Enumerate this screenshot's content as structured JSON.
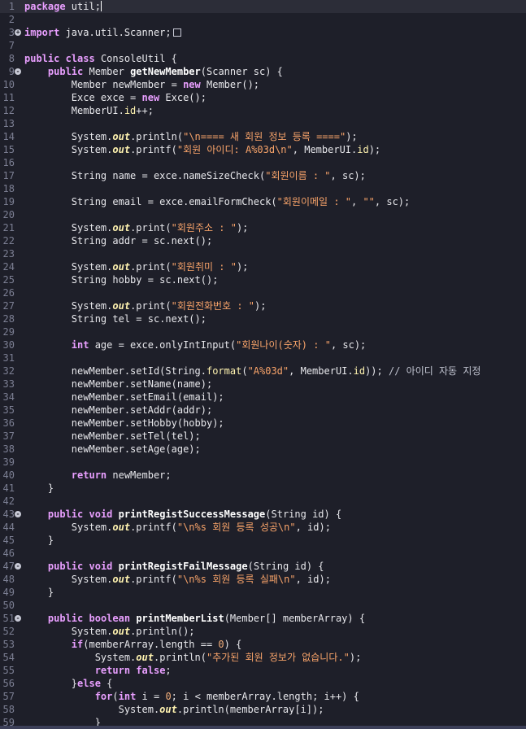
{
  "editor": {
    "lines": [
      {
        "n": "1",
        "tokens": [
          [
            "k",
            "package"
          ],
          [
            "t",
            " util;"
          ]
        ]
      },
      {
        "n": "2",
        "tokens": []
      },
      {
        "n": "3",
        "tokens": [
          [
            "k",
            "import"
          ],
          [
            "t",
            " java.util.Scanner;"
          ]
        ]
      },
      {
        "n": "7",
        "tokens": []
      },
      {
        "n": "8",
        "tokens": [
          [
            "k",
            "public"
          ],
          [
            "t",
            " "
          ],
          [
            "k",
            "class"
          ],
          [
            "t",
            " ConsoleUtil {"
          ]
        ]
      },
      {
        "n": "9",
        "tokens": [
          [
            "t",
            "    "
          ],
          [
            "k",
            "public"
          ],
          [
            "t",
            " Member "
          ],
          [
            "fn",
            "getNewMember"
          ],
          [
            "t",
            "(Scanner sc) {"
          ]
        ]
      },
      {
        "n": "10",
        "tokens": [
          [
            "t",
            "        Member newMember = "
          ],
          [
            "k",
            "new"
          ],
          [
            "t",
            " Member();"
          ]
        ]
      },
      {
        "n": "11",
        "tokens": [
          [
            "t",
            "        Exce exce = "
          ],
          [
            "k",
            "new"
          ],
          [
            "t",
            " Exce();"
          ]
        ]
      },
      {
        "n": "12",
        "tokens": [
          [
            "t",
            "        MemberUI."
          ],
          [
            "m",
            "id"
          ],
          [
            "t",
            "++;"
          ]
        ]
      },
      {
        "n": "13",
        "tokens": []
      },
      {
        "n": "14",
        "tokens": [
          [
            "t",
            "        System."
          ],
          [
            "f",
            "out"
          ],
          [
            "t",
            ".println("
          ],
          [
            "s",
            "\"\\n==== 새 회원 정보 등록 ====\""
          ],
          [
            "t",
            ");"
          ]
        ]
      },
      {
        "n": "15",
        "tokens": [
          [
            "t",
            "        System."
          ],
          [
            "f",
            "out"
          ],
          [
            "t",
            ".printf("
          ],
          [
            "s",
            "\"회원 아이디: A%03d\\n\""
          ],
          [
            "t",
            ", MemberUI."
          ],
          [
            "m",
            "id"
          ],
          [
            "t",
            ");"
          ]
        ]
      },
      {
        "n": "16",
        "tokens": []
      },
      {
        "n": "17",
        "tokens": [
          [
            "t",
            "        String name = exce.nameSizeCheck("
          ],
          [
            "s",
            "\"회원이름 : \""
          ],
          [
            "t",
            ", sc);"
          ]
        ]
      },
      {
        "n": "18",
        "tokens": []
      },
      {
        "n": "19",
        "tokens": [
          [
            "t",
            "        String email = exce.emailFormCheck("
          ],
          [
            "s",
            "\"회원이메일 : \""
          ],
          [
            "t",
            ", "
          ],
          [
            "s",
            "\"\""
          ],
          [
            "t",
            ", sc);"
          ]
        ]
      },
      {
        "n": "20",
        "tokens": []
      },
      {
        "n": "21",
        "tokens": [
          [
            "t",
            "        System."
          ],
          [
            "f",
            "out"
          ],
          [
            "t",
            ".print("
          ],
          [
            "s",
            "\"회원주소 : \""
          ],
          [
            "t",
            ");"
          ]
        ]
      },
      {
        "n": "22",
        "tokens": [
          [
            "t",
            "        String addr = sc.next();"
          ]
        ]
      },
      {
        "n": "23",
        "tokens": []
      },
      {
        "n": "24",
        "tokens": [
          [
            "t",
            "        System."
          ],
          [
            "f",
            "out"
          ],
          [
            "t",
            ".print("
          ],
          [
            "s",
            "\"회원취미 : \""
          ],
          [
            "t",
            ");"
          ]
        ]
      },
      {
        "n": "25",
        "tokens": [
          [
            "t",
            "        String hobby = sc.next();"
          ]
        ]
      },
      {
        "n": "26",
        "tokens": []
      },
      {
        "n": "27",
        "tokens": [
          [
            "t",
            "        System."
          ],
          [
            "f",
            "out"
          ],
          [
            "t",
            ".print("
          ],
          [
            "s",
            "\"회원전화번호 : \""
          ],
          [
            "t",
            ");"
          ]
        ]
      },
      {
        "n": "28",
        "tokens": [
          [
            "t",
            "        String tel = sc.next();"
          ]
        ]
      },
      {
        "n": "29",
        "tokens": []
      },
      {
        "n": "30",
        "tokens": [
          [
            "t",
            "        "
          ],
          [
            "k",
            "int"
          ],
          [
            "t",
            " age = exce.onlyIntInput("
          ],
          [
            "s",
            "\"회원나이(숫자) : \""
          ],
          [
            "t",
            ", sc);"
          ]
        ]
      },
      {
        "n": "31",
        "tokens": []
      },
      {
        "n": "32",
        "tokens": [
          [
            "t",
            "        newMember.setId(String."
          ],
          [
            "m",
            "format"
          ],
          [
            "t",
            "("
          ],
          [
            "s",
            "\"A%03d\""
          ],
          [
            "t",
            ", MemberUI."
          ],
          [
            "m",
            "id"
          ],
          [
            "t",
            "));"
          ],
          [
            "c",
            " // 아이디 자동 지정"
          ]
        ]
      },
      {
        "n": "33",
        "tokens": [
          [
            "t",
            "        newMember.setName(name);"
          ]
        ]
      },
      {
        "n": "34",
        "tokens": [
          [
            "t",
            "        newMember.setEmail(email);"
          ]
        ]
      },
      {
        "n": "35",
        "tokens": [
          [
            "t",
            "        newMember.setAddr(addr);"
          ]
        ]
      },
      {
        "n": "36",
        "tokens": [
          [
            "t",
            "        newMember.setHobby(hobby);"
          ]
        ]
      },
      {
        "n": "37",
        "tokens": [
          [
            "t",
            "        newMember.setTel(tel);"
          ]
        ]
      },
      {
        "n": "38",
        "tokens": [
          [
            "t",
            "        newMember.setAge(age);"
          ]
        ]
      },
      {
        "n": "39",
        "tokens": []
      },
      {
        "n": "40",
        "tokens": [
          [
            "t",
            "        "
          ],
          [
            "k",
            "return"
          ],
          [
            "t",
            " newMember;"
          ]
        ]
      },
      {
        "n": "41",
        "tokens": [
          [
            "t",
            "    }"
          ]
        ]
      },
      {
        "n": "42",
        "tokens": []
      },
      {
        "n": "43",
        "tokens": [
          [
            "t",
            "    "
          ],
          [
            "k",
            "public"
          ],
          [
            "t",
            " "
          ],
          [
            "k",
            "void"
          ],
          [
            "t",
            " "
          ],
          [
            "fn",
            "printRegistSuccessMessage"
          ],
          [
            "t",
            "(String id) {"
          ]
        ]
      },
      {
        "n": "44",
        "tokens": [
          [
            "t",
            "        System."
          ],
          [
            "f",
            "out"
          ],
          [
            "t",
            ".printf("
          ],
          [
            "s",
            "\"\\n%s 회원 등록 성공\\n\""
          ],
          [
            "t",
            ", id);"
          ]
        ]
      },
      {
        "n": "45",
        "tokens": [
          [
            "t",
            "    }"
          ]
        ]
      },
      {
        "n": "46",
        "tokens": []
      },
      {
        "n": "47",
        "tokens": [
          [
            "t",
            "    "
          ],
          [
            "k",
            "public"
          ],
          [
            "t",
            " "
          ],
          [
            "k",
            "void"
          ],
          [
            "t",
            " "
          ],
          [
            "fn",
            "printRegistFailMessage"
          ],
          [
            "t",
            "(String id) {"
          ]
        ]
      },
      {
        "n": "48",
        "tokens": [
          [
            "t",
            "        System."
          ],
          [
            "f",
            "out"
          ],
          [
            "t",
            ".printf("
          ],
          [
            "s",
            "\"\\n%s 회원 등록 실패\\n\""
          ],
          [
            "t",
            ", id);"
          ]
        ]
      },
      {
        "n": "49",
        "tokens": [
          [
            "t",
            "    }"
          ]
        ]
      },
      {
        "n": "50",
        "tokens": []
      },
      {
        "n": "51",
        "tokens": [
          [
            "t",
            "    "
          ],
          [
            "k",
            "public"
          ],
          [
            "t",
            " "
          ],
          [
            "k",
            "boolean"
          ],
          [
            "t",
            " "
          ],
          [
            "fn",
            "printMemberList"
          ],
          [
            "t",
            "(Member[] memberArray) {"
          ]
        ]
      },
      {
        "n": "52",
        "tokens": [
          [
            "t",
            "        System."
          ],
          [
            "f",
            "out"
          ],
          [
            "t",
            ".println();"
          ]
        ]
      },
      {
        "n": "53",
        "tokens": [
          [
            "t",
            "        "
          ],
          [
            "k",
            "if"
          ],
          [
            "t",
            "(memberArray.length == "
          ],
          [
            "n",
            "0"
          ],
          [
            "t",
            ") {"
          ]
        ]
      },
      {
        "n": "54",
        "tokens": [
          [
            "t",
            "            System."
          ],
          [
            "f",
            "out"
          ],
          [
            "t",
            ".println("
          ],
          [
            "s",
            "\"추가된 회원 정보가 없습니다.\""
          ],
          [
            "t",
            ");"
          ]
        ]
      },
      {
        "n": "55",
        "tokens": [
          [
            "t",
            "            "
          ],
          [
            "k",
            "return"
          ],
          [
            "t",
            " "
          ],
          [
            "k",
            "false"
          ],
          [
            "t",
            ";"
          ]
        ]
      },
      {
        "n": "56",
        "tokens": [
          [
            "t",
            "        }"
          ],
          [
            "k",
            "else"
          ],
          [
            "t",
            " {"
          ]
        ]
      },
      {
        "n": "57",
        "tokens": [
          [
            "t",
            "            "
          ],
          [
            "k",
            "for"
          ],
          [
            "t",
            "("
          ],
          [
            "k",
            "int"
          ],
          [
            "t",
            " i = "
          ],
          [
            "n",
            "0"
          ],
          [
            "t",
            "; i < memberArray.length; i++) {"
          ]
        ]
      },
      {
        "n": "58",
        "tokens": [
          [
            "t",
            "                System."
          ],
          [
            "f",
            "out"
          ],
          [
            "t",
            ".println(memberArray[i]);"
          ]
        ]
      },
      {
        "n": "59",
        "tokens": [
          [
            "t",
            "            }"
          ]
        ]
      }
    ],
    "fold_markers": {
      "3": "+",
      "9": "-",
      "43": "-",
      "47": "-",
      "51": "-"
    },
    "current_line": "1"
  }
}
